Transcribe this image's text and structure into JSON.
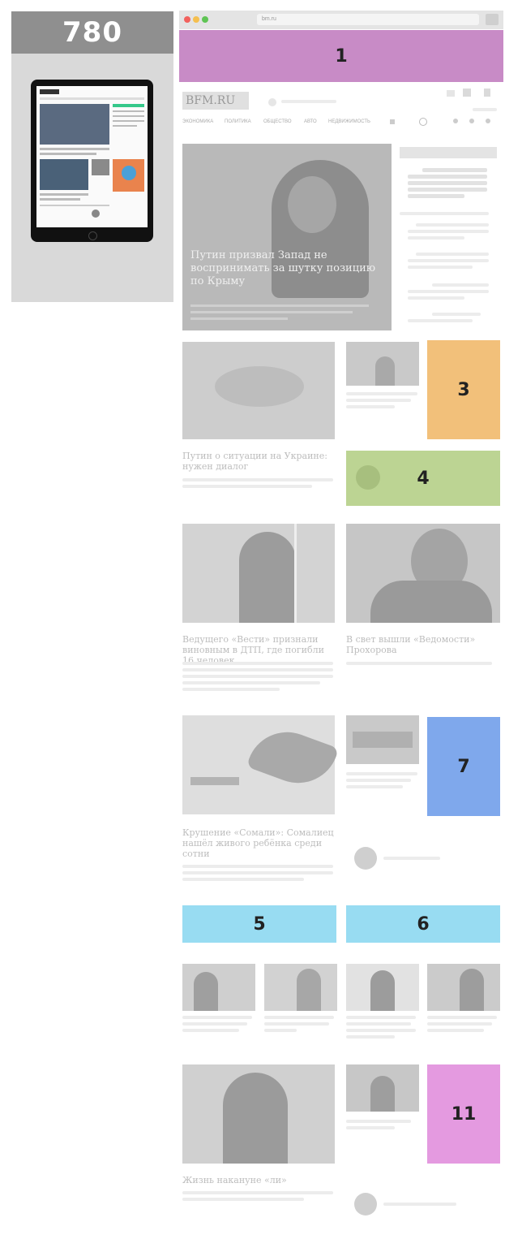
{
  "breakpoint": {
    "width_label": "780"
  },
  "browser": {
    "url": "bm.ru",
    "colors": {
      "close": "#f2615d",
      "minimize": "#f5bf4f",
      "zoom": "#5fc454"
    }
  },
  "site": {
    "logo": "BFM.RU",
    "nav": [
      "ЭКОНОМИКА",
      "ПОЛИТИКА",
      "ОБЩЕСТВО",
      "АВТО",
      "НЕДВИЖИМОСТЬ"
    ]
  },
  "ads": [
    {
      "label": "1",
      "color": "#c88bc6"
    },
    {
      "label": "3",
      "color": "#f2c07a"
    },
    {
      "label": "4",
      "color": "#bcd493"
    },
    {
      "label": "7",
      "color": "#7fa8ec"
    },
    {
      "label": "5",
      "color": "#98dcf2"
    },
    {
      "label": "6",
      "color": "#98dcf2"
    },
    {
      "label": "11",
      "color": "#e49ae0"
    }
  ],
  "articles": {
    "hero_title": "Путин призвал Запад не воспринимать за шутку позицию по Крыму",
    "a2_title": "Путин о ситуации на Украине: нужен диалог",
    "a3_title": "Ведущего «Вести» признали виновным в ДТП, где погибли 16 человек",
    "a4_title": "В свет вышли «Ведомости» Прохорова",
    "a5_title": "Крушение «Сомали»: Сомалиец нашёл живого ребёнка среди сотни",
    "a6_title": "Жизнь накануне «ли»"
  }
}
